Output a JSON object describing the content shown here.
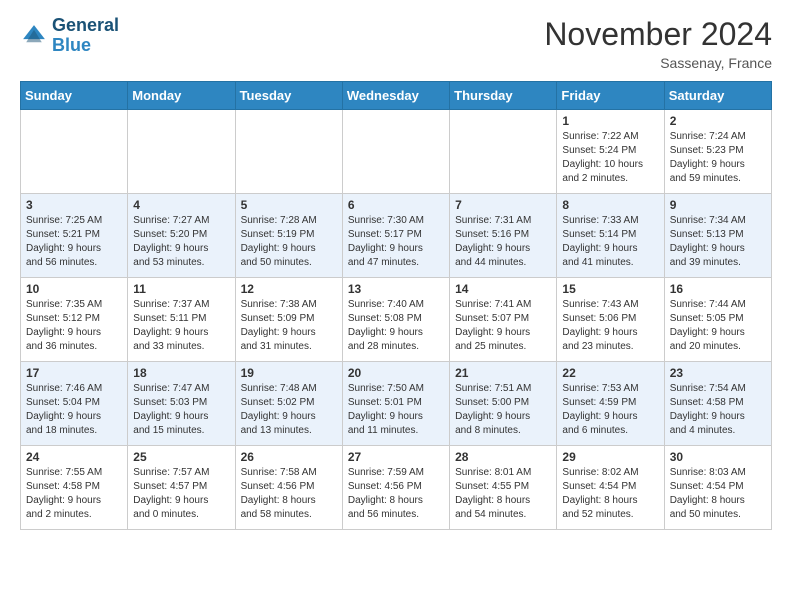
{
  "header": {
    "logo_line1": "General",
    "logo_line2": "Blue",
    "month_year": "November 2024",
    "location": "Sassenay, France"
  },
  "weekdays": [
    "Sunday",
    "Monday",
    "Tuesday",
    "Wednesday",
    "Thursday",
    "Friday",
    "Saturday"
  ],
  "weeks": [
    [
      {
        "day": "",
        "info": ""
      },
      {
        "day": "",
        "info": ""
      },
      {
        "day": "",
        "info": ""
      },
      {
        "day": "",
        "info": ""
      },
      {
        "day": "",
        "info": ""
      },
      {
        "day": "1",
        "info": "Sunrise: 7:22 AM\nSunset: 5:24 PM\nDaylight: 10 hours\nand 2 minutes."
      },
      {
        "day": "2",
        "info": "Sunrise: 7:24 AM\nSunset: 5:23 PM\nDaylight: 9 hours\nand 59 minutes."
      }
    ],
    [
      {
        "day": "3",
        "info": "Sunrise: 7:25 AM\nSunset: 5:21 PM\nDaylight: 9 hours\nand 56 minutes."
      },
      {
        "day": "4",
        "info": "Sunrise: 7:27 AM\nSunset: 5:20 PM\nDaylight: 9 hours\nand 53 minutes."
      },
      {
        "day": "5",
        "info": "Sunrise: 7:28 AM\nSunset: 5:19 PM\nDaylight: 9 hours\nand 50 minutes."
      },
      {
        "day": "6",
        "info": "Sunrise: 7:30 AM\nSunset: 5:17 PM\nDaylight: 9 hours\nand 47 minutes."
      },
      {
        "day": "7",
        "info": "Sunrise: 7:31 AM\nSunset: 5:16 PM\nDaylight: 9 hours\nand 44 minutes."
      },
      {
        "day": "8",
        "info": "Sunrise: 7:33 AM\nSunset: 5:14 PM\nDaylight: 9 hours\nand 41 minutes."
      },
      {
        "day": "9",
        "info": "Sunrise: 7:34 AM\nSunset: 5:13 PM\nDaylight: 9 hours\nand 39 minutes."
      }
    ],
    [
      {
        "day": "10",
        "info": "Sunrise: 7:35 AM\nSunset: 5:12 PM\nDaylight: 9 hours\nand 36 minutes."
      },
      {
        "day": "11",
        "info": "Sunrise: 7:37 AM\nSunset: 5:11 PM\nDaylight: 9 hours\nand 33 minutes."
      },
      {
        "day": "12",
        "info": "Sunrise: 7:38 AM\nSunset: 5:09 PM\nDaylight: 9 hours\nand 31 minutes."
      },
      {
        "day": "13",
        "info": "Sunrise: 7:40 AM\nSunset: 5:08 PM\nDaylight: 9 hours\nand 28 minutes."
      },
      {
        "day": "14",
        "info": "Sunrise: 7:41 AM\nSunset: 5:07 PM\nDaylight: 9 hours\nand 25 minutes."
      },
      {
        "day": "15",
        "info": "Sunrise: 7:43 AM\nSunset: 5:06 PM\nDaylight: 9 hours\nand 23 minutes."
      },
      {
        "day": "16",
        "info": "Sunrise: 7:44 AM\nSunset: 5:05 PM\nDaylight: 9 hours\nand 20 minutes."
      }
    ],
    [
      {
        "day": "17",
        "info": "Sunrise: 7:46 AM\nSunset: 5:04 PM\nDaylight: 9 hours\nand 18 minutes."
      },
      {
        "day": "18",
        "info": "Sunrise: 7:47 AM\nSunset: 5:03 PM\nDaylight: 9 hours\nand 15 minutes."
      },
      {
        "day": "19",
        "info": "Sunrise: 7:48 AM\nSunset: 5:02 PM\nDaylight: 9 hours\nand 13 minutes."
      },
      {
        "day": "20",
        "info": "Sunrise: 7:50 AM\nSunset: 5:01 PM\nDaylight: 9 hours\nand 11 minutes."
      },
      {
        "day": "21",
        "info": "Sunrise: 7:51 AM\nSunset: 5:00 PM\nDaylight: 9 hours\nand 8 minutes."
      },
      {
        "day": "22",
        "info": "Sunrise: 7:53 AM\nSunset: 4:59 PM\nDaylight: 9 hours\nand 6 minutes."
      },
      {
        "day": "23",
        "info": "Sunrise: 7:54 AM\nSunset: 4:58 PM\nDaylight: 9 hours\nand 4 minutes."
      }
    ],
    [
      {
        "day": "24",
        "info": "Sunrise: 7:55 AM\nSunset: 4:58 PM\nDaylight: 9 hours\nand 2 minutes."
      },
      {
        "day": "25",
        "info": "Sunrise: 7:57 AM\nSunset: 4:57 PM\nDaylight: 9 hours\nand 0 minutes."
      },
      {
        "day": "26",
        "info": "Sunrise: 7:58 AM\nSunset: 4:56 PM\nDaylight: 8 hours\nand 58 minutes."
      },
      {
        "day": "27",
        "info": "Sunrise: 7:59 AM\nSunset: 4:56 PM\nDaylight: 8 hours\nand 56 minutes."
      },
      {
        "day": "28",
        "info": "Sunrise: 8:01 AM\nSunset: 4:55 PM\nDaylight: 8 hours\nand 54 minutes."
      },
      {
        "day": "29",
        "info": "Sunrise: 8:02 AM\nSunset: 4:54 PM\nDaylight: 8 hours\nand 52 minutes."
      },
      {
        "day": "30",
        "info": "Sunrise: 8:03 AM\nSunset: 4:54 PM\nDaylight: 8 hours\nand 50 minutes."
      }
    ]
  ]
}
